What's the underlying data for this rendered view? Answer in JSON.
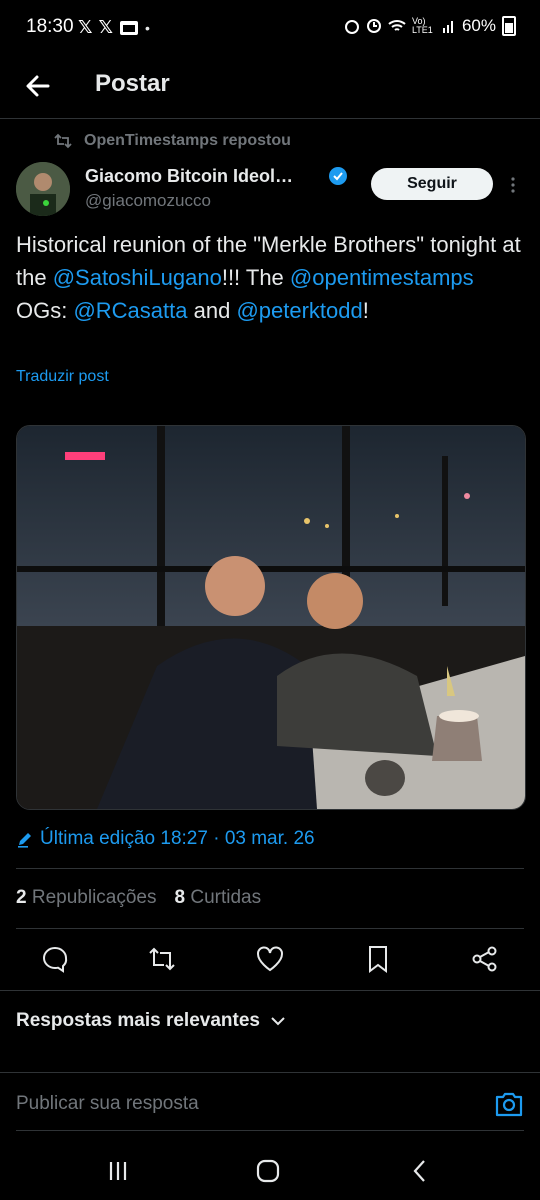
{
  "status_bar": {
    "time": "18:30",
    "app_icons": [
      "x-logo",
      "x-logo",
      "photo-icon",
      "dot"
    ],
    "right_text": "60%",
    "network": "Vo) LTE1"
  },
  "header": {
    "title": "Postar"
  },
  "repost": {
    "label": "OpenTimestamps repostou"
  },
  "author": {
    "name": "Giacomo Bitcoin Ideol…",
    "handle": "@giacomozucco",
    "follow_label": "Seguir"
  },
  "tweet": {
    "parts": [
      {
        "text": "Historical reunion of the \"Merkle Brothers\" tonight at the ",
        "mention": false
      },
      {
        "text": "@SatoshiLugano",
        "mention": true
      },
      {
        "text": "!!! The ",
        "mention": false
      },
      {
        "text": "@opentimestamps",
        "mention": true
      },
      {
        "text": " OGs: ",
        "mention": false
      },
      {
        "text": "@RCasatta",
        "mention": true
      },
      {
        "text": " and ",
        "mention": false
      },
      {
        "text": "@peterktodd",
        "mention": true
      },
      {
        "text": "!",
        "mention": false
      }
    ],
    "translate_label": "Traduzir post"
  },
  "meta": {
    "edited_label": "Última edição 18:27 · 03 mar. 26",
    "reposts_count": "2",
    "reposts_label": "Republicações",
    "likes_count": "8",
    "likes_label": "Curtidas"
  },
  "replies": {
    "sort_label": "Respostas mais relevantes",
    "input_placeholder": "Publicar sua resposta"
  },
  "colors": {
    "accent": "#1d9bf0",
    "background": "#000000",
    "text": "#e7e9ea",
    "muted": "#71767b"
  }
}
